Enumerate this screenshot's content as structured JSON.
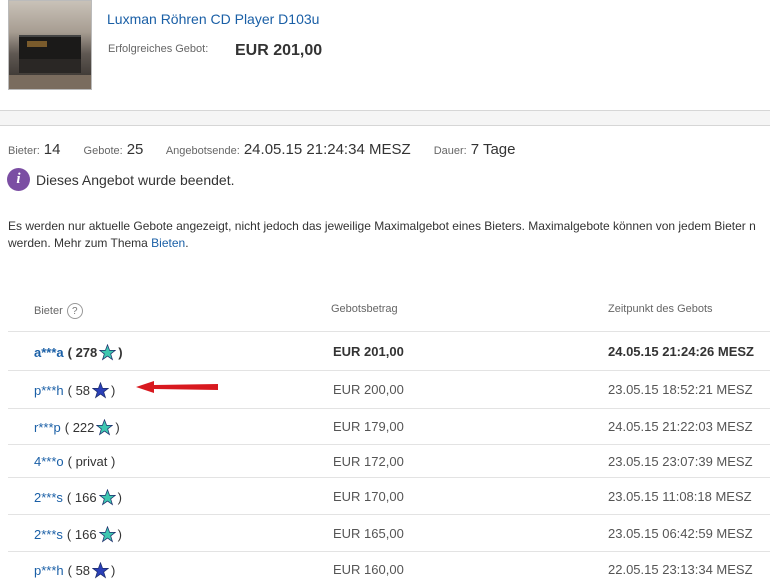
{
  "item": {
    "title": "Luxman Röhren CD Player D103u",
    "winning_bid_label": "Erfolgreiches Gebot:",
    "winning_bid_value": "EUR 201,00"
  },
  "stats": {
    "bidders_label": "Bieter:",
    "bidders_value": "14",
    "bids_label": "Gebote:",
    "bids_value": "25",
    "end_label": "Angebotsende:",
    "end_value": "24.05.15 21:24:34 MESZ",
    "duration_label": "Dauer:",
    "duration_value": "7 Tage"
  },
  "notice": {
    "icon": "info-icon",
    "text": "Dieses Angebot wurde beendet."
  },
  "info": {
    "text_line1": "Es werden nur aktuelle Gebote angezeigt, nicht jedoch das jeweilige Maximalgebot eines Bieters. Maximalgebote können von jedem Bieter n",
    "text_line2": "werden. Mehr zum Thema ",
    "link": "Bieten",
    "after_link": "."
  },
  "table": {
    "headers": {
      "bidder": "Bieter",
      "amount": "Gebotsbetrag",
      "time": "Zeitpunkt des Gebots"
    },
    "rows": [
      {
        "bidder": "a***a",
        "feedback": "( 278",
        "feedback_close": ")",
        "star": "turquoise",
        "amount": "EUR 201,00",
        "time": "24.05.15 21:24:26 MESZ",
        "bold": true
      },
      {
        "bidder": "p***h",
        "feedback": "( 58",
        "feedback_close": ")",
        "star": "blue",
        "amount": "EUR 200,00",
        "time": "23.05.15 18:52:21 MESZ",
        "bold": false
      },
      {
        "bidder": "r***p",
        "feedback": "( 222",
        "feedback_close": ")",
        "star": "turquoise",
        "amount": "EUR 179,00",
        "time": "24.05.15 21:22:03 MESZ",
        "bold": false
      },
      {
        "bidder": "4***o",
        "feedback": "( privat )",
        "feedback_close": "",
        "star": "none",
        "amount": "EUR 172,00",
        "time": "23.05.15 23:07:39 MESZ",
        "bold": false
      },
      {
        "bidder": "2***s",
        "feedback": "( 166",
        "feedback_close": ")",
        "star": "turquoise",
        "amount": "EUR 170,00",
        "time": "23.05.15 11:08:18 MESZ",
        "bold": false
      },
      {
        "bidder": "2***s",
        "feedback": "( 166",
        "feedback_close": ")",
        "star": "turquoise",
        "amount": "EUR 165,00",
        "time": "23.05.15 06:42:59 MESZ",
        "bold": false
      },
      {
        "bidder": "p***h",
        "feedback": "( 58",
        "feedback_close": ")",
        "star": "blue",
        "amount": "EUR 160,00",
        "time": "22.05.15 23:13:34 MESZ",
        "bold": false
      }
    ]
  },
  "colors": {
    "link": "#1a5fa6",
    "star_turquoise": "#3fc7b1",
    "star_blue": "#2a3fb8",
    "arrow": "#d8191f",
    "notice_icon": "#7b4ea3"
  }
}
